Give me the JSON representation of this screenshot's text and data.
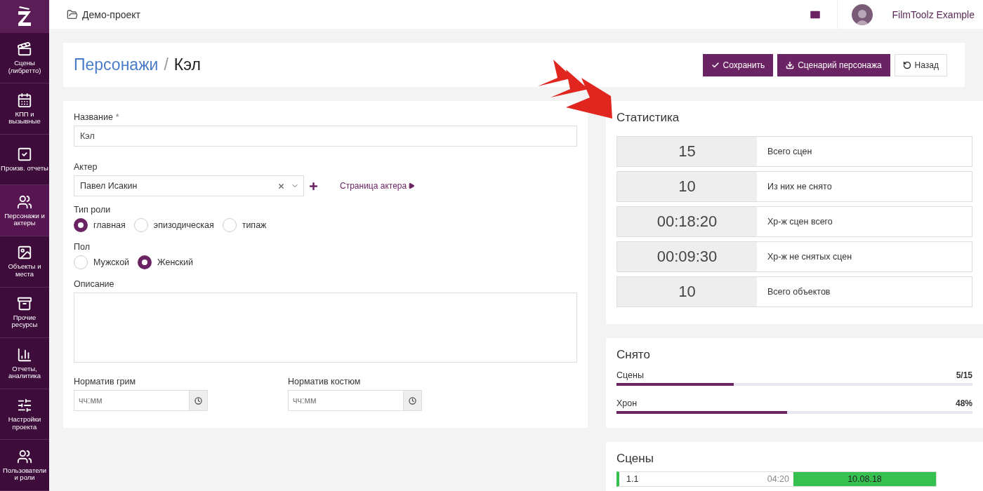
{
  "sidebar": {
    "items": [
      {
        "label": "Сцены (либретто)",
        "selected": false
      },
      {
        "label": "КПП и вызывные",
        "selected": false
      },
      {
        "label": "Произв. отчеты",
        "selected": false
      },
      {
        "label": "Персонажи и актеры",
        "selected": true
      },
      {
        "label": "Объекты и места",
        "selected": false
      },
      {
        "label": "Прочие ресурсы",
        "selected": false
      },
      {
        "label": "Отчеты, аналитика",
        "selected": false
      },
      {
        "label": "Настройки проекта",
        "selected": false
      },
      {
        "label": "Пользователи и роли",
        "selected": false
      }
    ]
  },
  "topbar": {
    "project": "Демо-проект",
    "user": "FilmToolz Example"
  },
  "header": {
    "breadcrumb": "Персонажи",
    "separator": "/",
    "title": "Кэл",
    "buttons": [
      {
        "label": "Сохранить",
        "kind": "primary"
      },
      {
        "label": "Сценарий персонажа",
        "kind": "primary"
      },
      {
        "label": "Назад",
        "kind": "default"
      }
    ]
  },
  "form": {
    "name": {
      "label": "Название",
      "required_mark": "*",
      "value": "Кэл"
    },
    "actor": {
      "label": "Актер",
      "value": "Павел Исакин",
      "link": "Страница актера"
    },
    "role_type": {
      "label": "Тип роли",
      "options": [
        {
          "label": "главная",
          "selected": true
        },
        {
          "label": "эпизодическая",
          "selected": false
        },
        {
          "label": "типаж",
          "selected": false
        }
      ]
    },
    "gender": {
      "label": "Пол",
      "options": [
        {
          "label": "Мужской",
          "selected": false
        },
        {
          "label": "Женский",
          "selected": true
        }
      ]
    },
    "description": {
      "label": "Описание"
    },
    "times": [
      {
        "label": "Норматив грим",
        "placeholder": "чч:мм"
      },
      {
        "label": "Норматив костюм",
        "placeholder": "чч:мм"
      }
    ]
  },
  "stats": {
    "title": "Статистика",
    "rows": [
      {
        "value": "15",
        "label": "Всего сцен"
      },
      {
        "value": "10",
        "label": "Из них не снято"
      },
      {
        "value": "00:18:20",
        "label": "Хр-ж сцен всего"
      },
      {
        "value": "00:09:30",
        "label": "Хр-ж не снятых сцен"
      },
      {
        "value": "10",
        "label": "Всего объектов"
      }
    ]
  },
  "shot": {
    "title": "Снято",
    "bars": [
      {
        "label": "Сцены",
        "reading": "5/15",
        "level": 0.33
      },
      {
        "label": "Хрон",
        "reading": "48%",
        "level": 0.48
      }
    ]
  },
  "scenes": {
    "title": "Сцены",
    "rows": [
      {
        "number": "1.1",
        "duration": "04:20",
        "date": "10.08.18"
      }
    ]
  }
}
